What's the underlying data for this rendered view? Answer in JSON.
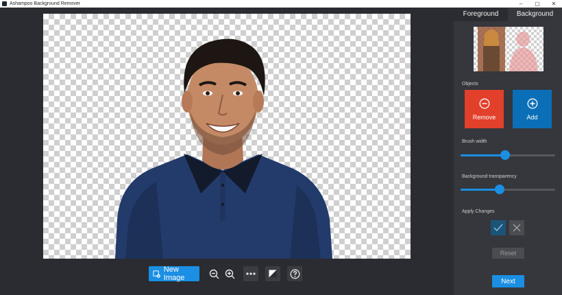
{
  "window": {
    "title": "Ashampoo Background Remover",
    "controls": [
      "–",
      "▢",
      "✕"
    ]
  },
  "toolbar": {
    "new_image_label": "New Image",
    "icons": [
      "new-image-icon",
      "zoom-out-icon",
      "zoom-in-icon",
      "more-icon",
      "compare-icon",
      "help-icon"
    ]
  },
  "panel": {
    "tabs": [
      {
        "label": "Foreground",
        "active": true
      },
      {
        "label": "Background",
        "active": false
      }
    ],
    "objects_label": "Objects",
    "remove_label": "Remove",
    "add_label": "Add",
    "brush_width_label": "Brush width",
    "brush_width_value": 0.47,
    "bg_transparency_label": "Background transparency",
    "bg_transparency_value": 0.41,
    "apply_changes_label": "Apply Changes",
    "reset_label": "Reset",
    "next_label": "Next"
  },
  "colors": {
    "accent": "#1a8fe3",
    "remove": "#e2402b",
    "add": "#0b6fb8",
    "background": "#2a2c31",
    "panel": "#35373c"
  }
}
